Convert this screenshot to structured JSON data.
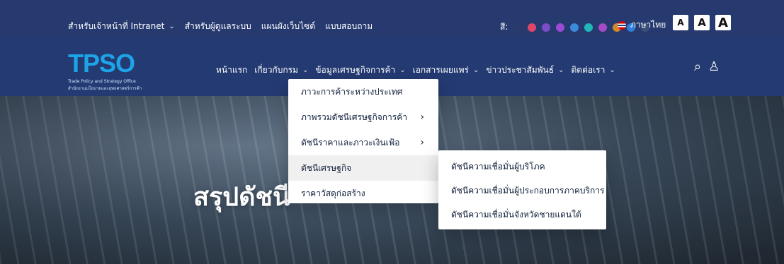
{
  "topbar": {
    "links": [
      {
        "label": "สำหรับเจ้าหน้าที่ Intranet",
        "has_chevron": true
      },
      {
        "label": "สำหรับผู้ดูแลระบบ",
        "has_chevron": false
      },
      {
        "label": "แผนผังเว็บไซต์",
        "has_chevron": false
      },
      {
        "label": "แบบสอบถาม",
        "has_chevron": false
      }
    ],
    "color_label": "สี:",
    "color_dots": [
      "#2a3a6a",
      "#e0466a",
      "#7b4cc8",
      "#9a4bd6",
      "#3c8bd9",
      "#1fb7b7",
      "#a64ac7",
      "#d3872a",
      "#2e7dd6",
      "#3a4f7a"
    ],
    "language_label": "ภาษาไทย",
    "font_size_buttons": [
      "A",
      "A",
      "A"
    ]
  },
  "header": {
    "logo_text": "TPSO",
    "logo_sub1": "Trade Policy and Strategy Office",
    "logo_sub2": "สำนักงานนโยบายและยุทธศาสตร์การค้า",
    "menu": [
      {
        "label": "หน้าแรก",
        "has_chevron": false
      },
      {
        "label": "เกี่ยวกับกรม",
        "has_chevron": true
      },
      {
        "label": "ข้อมูลเศรษฐกิจการค้า",
        "has_chevron": true
      },
      {
        "label": "เอกสารเผยแพร่",
        "has_chevron": true
      },
      {
        "label": "ข่าวประชาสัมพันธ์",
        "has_chevron": true
      },
      {
        "label": "ติดต่อเรา",
        "has_chevron": true
      }
    ]
  },
  "dropdown": {
    "items": [
      {
        "label": "ภาวะการค้าระหว่างประเทศ",
        "has_chevron": false,
        "active": false
      },
      {
        "label": "ภาพรวมดัชนีเศรษฐกิจการค้า",
        "has_chevron": true,
        "active": false
      },
      {
        "label": "ดัชนีราคาและภาวะเงินเฟ้อ",
        "has_chevron": true,
        "active": false
      },
      {
        "label": "ดัชนีเศรษฐกิจ",
        "has_chevron": false,
        "active": true
      },
      {
        "label": "ราคาวัสดุก่อสร้าง",
        "has_chevron": false,
        "active": false
      }
    ]
  },
  "submenu": {
    "items": [
      {
        "label": "ดัชนีความเชื่อมั่นผู้บริโภค"
      },
      {
        "label": "ดัชนีความเชื่อมั่นผู้ประกอบการภาคบริการ"
      },
      {
        "label": "ดัชนีความเชื่อมั่นจังหวัดชายแดนใต้"
      }
    ]
  },
  "hero": {
    "title": "สรุปดัชนี"
  },
  "icons": {
    "search": "search-icon",
    "user": "user-icon"
  }
}
